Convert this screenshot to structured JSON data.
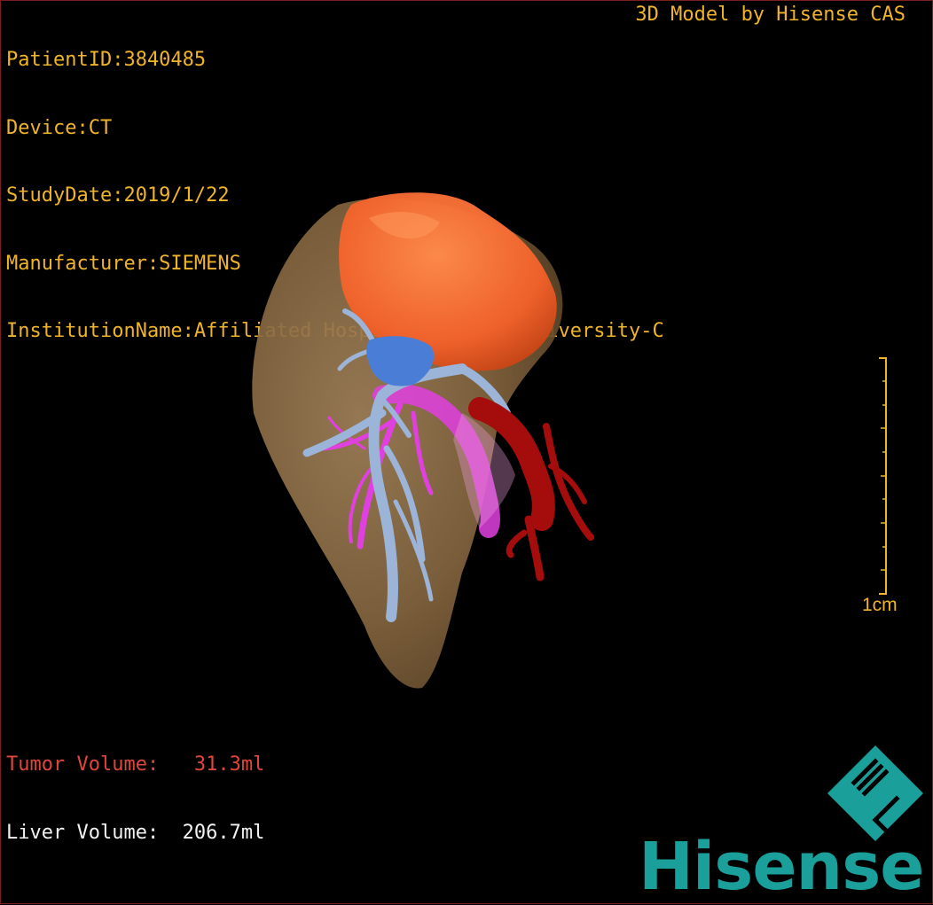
{
  "header": {
    "patient_id": "PatientID:3840485",
    "device": "Device:CT",
    "study_date": "StudyDate:2019/1/22",
    "manufacturer": "Manufacturer:SIEMENS",
    "institution": "InstitutionName:Affiliated Hospital Qingdao University-C",
    "model_credit": "3D Model by Hisense CAS"
  },
  "scale_bar": {
    "label": "1cm"
  },
  "volumes": {
    "tumor": "Tumor Volume:   31.3ml",
    "liver": "Liver Volume:  206.7ml"
  },
  "brand": {
    "name": "Hisense",
    "mark": "HL"
  },
  "colors": {
    "overlay_text": "#f0b429",
    "tumor_text": "#e0463a",
    "liver_text": "#f2f2f2",
    "liver": "#8a6a45",
    "tumor": "#f26a30",
    "portal_vein": "#9bb4d8",
    "hepatic_artery": "#e040e0",
    "vena_cava": "#b00d0d",
    "brand": "#1a9f9a"
  }
}
